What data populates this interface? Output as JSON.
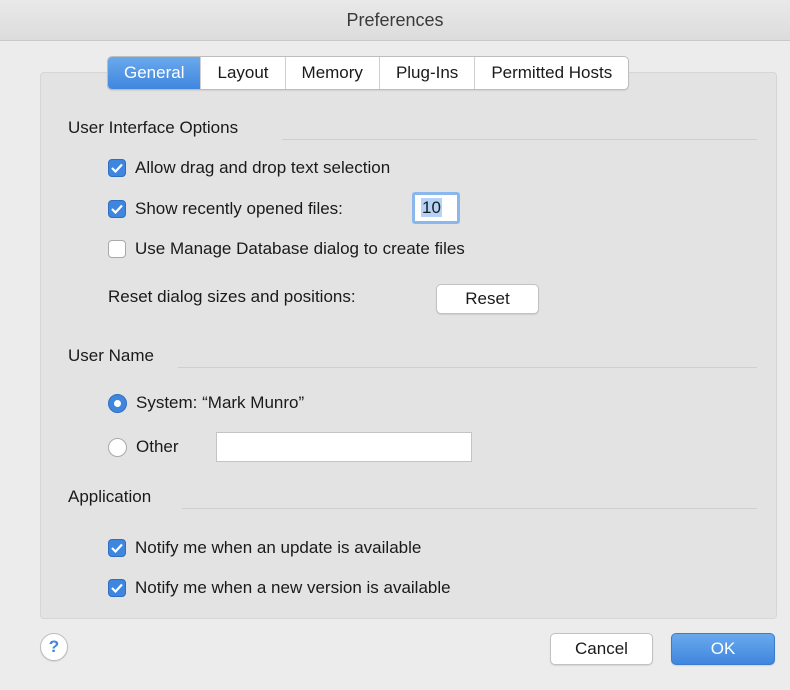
{
  "window": {
    "title": "Preferences"
  },
  "tabs": [
    {
      "label": "General",
      "active": true
    },
    {
      "label": "Layout",
      "active": false
    },
    {
      "label": "Memory",
      "active": false
    },
    {
      "label": "Plug-Ins",
      "active": false
    },
    {
      "label": "Permitted Hosts",
      "active": false
    }
  ],
  "ui_options": {
    "heading": "User Interface Options",
    "drag_drop": {
      "label": "Allow drag and drop text selection",
      "checked": true
    },
    "recent_files": {
      "label": "Show recently opened files:",
      "checked": true,
      "value": "10"
    },
    "manage_db": {
      "label": "Use Manage Database dialog to create files",
      "checked": false
    },
    "reset_label": "Reset dialog sizes and positions:",
    "reset_button": "Reset"
  },
  "user_name": {
    "heading": "User Name",
    "system": {
      "label": "System: “Mark Munro”",
      "selected": true
    },
    "other": {
      "label": "Other",
      "selected": false,
      "value": ""
    }
  },
  "application": {
    "heading": "Application",
    "notify_update": {
      "label": "Notify me when an update is available",
      "checked": true
    },
    "notify_version": {
      "label": "Notify me when a new version is available",
      "checked": true
    }
  },
  "footer": {
    "help": "?",
    "cancel": "Cancel",
    "ok": "OK"
  },
  "colors": {
    "accent": "#3f86de"
  }
}
